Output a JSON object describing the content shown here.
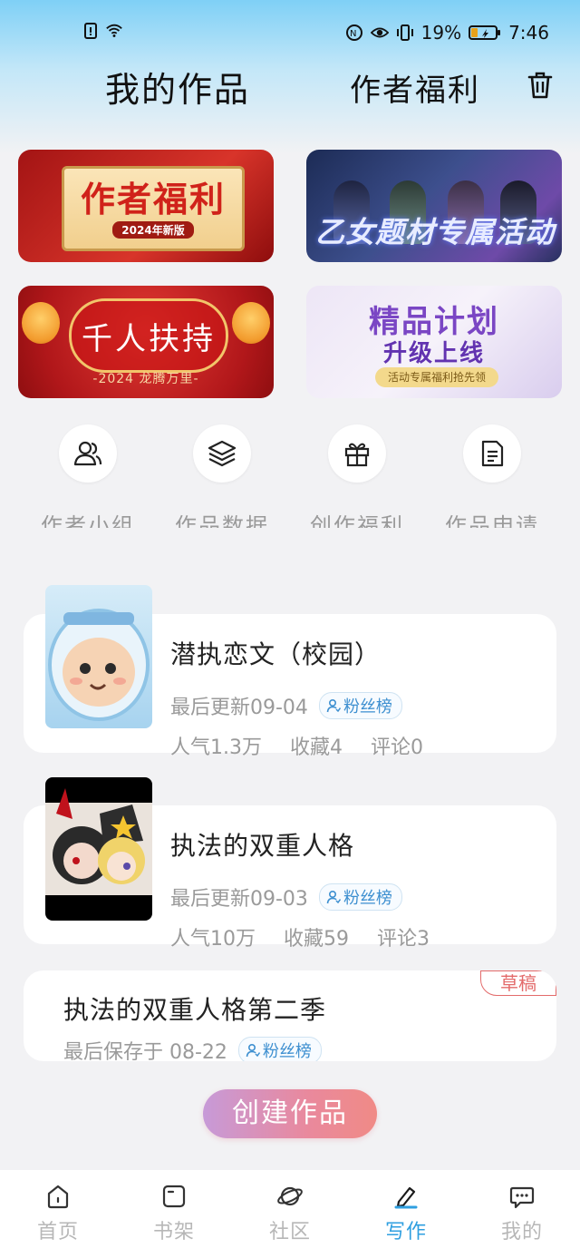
{
  "status_bar": {
    "battery": "19%",
    "time": "7:46"
  },
  "header": {
    "title": "我的作品",
    "welfare": "作者福利"
  },
  "banners": [
    {
      "title": "作者福利",
      "subtitle": "2024年新版"
    },
    {
      "title": "乙女题材专属活动"
    },
    {
      "title": "千人扶持",
      "subtitle": "-2024 龙腾万里-"
    },
    {
      "title": "精品计划",
      "subtitle": "升级上线",
      "note": "活动专属福利抢先领"
    }
  ],
  "quick_actions": [
    {
      "label": "作者小组",
      "icon": "users-icon"
    },
    {
      "label": "作品数据",
      "icon": "layers-icon"
    },
    {
      "label": "创作福利",
      "icon": "gift-icon"
    },
    {
      "label": "作品申请",
      "icon": "document-icon"
    }
  ],
  "works": [
    {
      "title": "潜执恋文（校园）",
      "updated": "最后更新09-04",
      "fans_badge": "粉丝榜",
      "popularity": "人气1.3万",
      "favorites": "收藏4",
      "comments": "评论0"
    },
    {
      "title": "执法的双重人格",
      "updated": "最后更新09-03",
      "fans_badge": "粉丝榜",
      "popularity": "人气10万",
      "favorites": "收藏59",
      "comments": "评论3"
    }
  ],
  "draft": {
    "tag": "草稿",
    "title": "执法的双重人格第二季",
    "saved": "最后保存于 08-22",
    "fans_badge": "粉丝榜"
  },
  "create_button": "创建作品",
  "bottom_nav": [
    {
      "label": "首页",
      "icon": "home-icon"
    },
    {
      "label": "书架",
      "icon": "bookshelf-icon"
    },
    {
      "label": "社区",
      "icon": "planet-icon"
    },
    {
      "label": "写作",
      "icon": "pen-icon",
      "active": true
    },
    {
      "label": "我的",
      "icon": "chat-icon"
    }
  ],
  "colors": {
    "accent": "#2f9fe0",
    "draft_tag": "#e36b6b",
    "create_button_start": "#c79ad8",
    "create_button_end": "#f08a86"
  }
}
